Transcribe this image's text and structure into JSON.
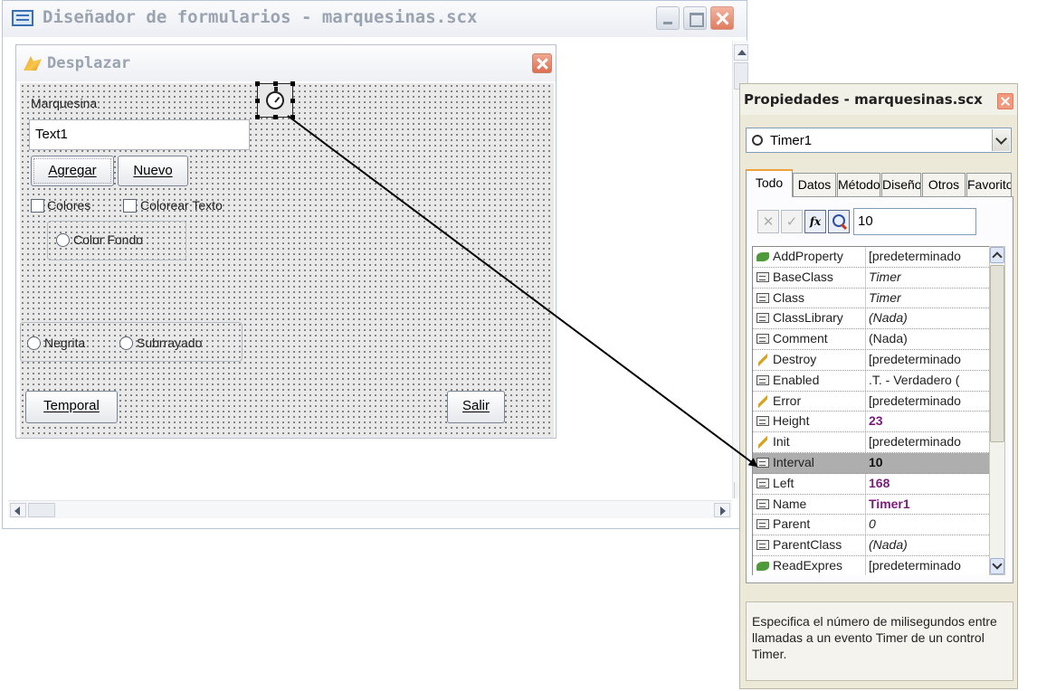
{
  "designer": {
    "title": "Diseñador de formularios - marquesinas.scx"
  },
  "form": {
    "title": "Desplazar",
    "label_marquesina": "Marquesina",
    "textbox_value": "Text1",
    "btn_agregar": "Agregar",
    "btn_nuevo": "Nuevo",
    "check_colores": "Colores",
    "check_colorear_texto": "Colorear Texto",
    "radio_color_fondo": "Color Fondo",
    "radio_negrita": "Negrita",
    "radio_subrrayado": "Subrrayado",
    "btn_temporal": "Temporal",
    "btn_salir": "Salir"
  },
  "properties": {
    "title": "Propiedades - marquesinas.scx",
    "object_selected": "Timer1",
    "tabs": [
      "Todo",
      "Datos",
      "Métodos",
      "Diseño",
      "Otros",
      "Favoritos"
    ],
    "tools": {
      "cancel": "✕",
      "accept": "✓",
      "fx": "fx"
    },
    "value_input": "10",
    "rows": [
      {
        "name": "AddProperty",
        "value": "[predeterminado",
        "kind": "method",
        "style": ""
      },
      {
        "name": "BaseClass",
        "value": "Timer",
        "kind": "prop",
        "style": "italic"
      },
      {
        "name": "Class",
        "value": "Timer",
        "kind": "prop",
        "style": "italic"
      },
      {
        "name": "ClassLibrary",
        "value": "(Nada)",
        "kind": "prop",
        "style": "italic"
      },
      {
        "name": "Comment",
        "value": "(Nada)",
        "kind": "prop",
        "style": ""
      },
      {
        "name": "Destroy",
        "value": "[predeterminado",
        "kind": "event",
        "style": ""
      },
      {
        "name": "Enabled",
        "value": ".T. - Verdadero (",
        "kind": "prop",
        "style": ""
      },
      {
        "name": "Error",
        "value": "[predeterminado",
        "kind": "event",
        "style": ""
      },
      {
        "name": "Height",
        "value": "23",
        "kind": "prop",
        "style": "bold"
      },
      {
        "name": "Init",
        "value": "[predeterminado",
        "kind": "event",
        "style": ""
      },
      {
        "name": "Interval",
        "value": "10",
        "kind": "prop",
        "style": "bold black",
        "selected": true
      },
      {
        "name": "Left",
        "value": "168",
        "kind": "prop",
        "style": "bold"
      },
      {
        "name": "Name",
        "value": "Timer1",
        "kind": "prop",
        "style": "bold"
      },
      {
        "name": "Parent",
        "value": "0",
        "kind": "prop",
        "style": "italic"
      },
      {
        "name": "ParentClass",
        "value": "(Nada)",
        "kind": "prop",
        "style": "italic"
      },
      {
        "name": "ReadExpres",
        "value": "[predeterminado",
        "kind": "method",
        "style": ""
      }
    ],
    "description": "Especifica el número de milisegundos entre llamadas a un evento Timer de un control Timer."
  }
}
